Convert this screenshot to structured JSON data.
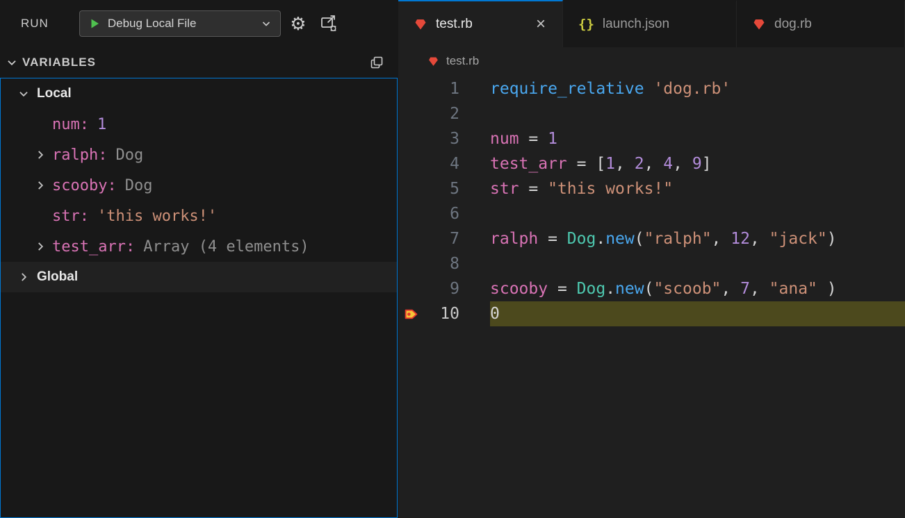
{
  "colors": {
    "accent": "#0078d4",
    "editor-bg": "#1f1f1f",
    "side-bg": "#181818",
    "current-line-bg": "#4c491d",
    "tok-kw": "#4aa8f0",
    "tok-var": "#d973b5",
    "tok-num": "#b38cdb",
    "tok-str": "#ce9178",
    "tok-cls": "#4ec9b0",
    "tok-plain": "#d6d6d6",
    "type-gray": "#8f8f8f",
    "line-num": "#6e7681",
    "ruby-red": "#e5493a",
    "json-yellow": "#cbcb41",
    "play-green": "#4fc14f"
  },
  "run_panel": {
    "title": "RUN",
    "config_label": "Debug Local File"
  },
  "variables_panel": {
    "header": "VARIABLES",
    "groups": [
      {
        "label": "Local",
        "expanded": true,
        "items": [
          {
            "name": "num",
            "value": "1",
            "kind": "number",
            "expandable": false
          },
          {
            "name": "ralph",
            "value": "Dog",
            "kind": "type",
            "expandable": true
          },
          {
            "name": "scooby",
            "value": "Dog",
            "kind": "type",
            "expandable": true
          },
          {
            "name": "str",
            "value": "'this works!'",
            "kind": "string",
            "expandable": false
          },
          {
            "name": "test_arr",
            "value": "Array (4 elements)",
            "kind": "type",
            "expandable": true
          }
        ]
      },
      {
        "label": "Global",
        "expanded": false,
        "items": []
      }
    ]
  },
  "tabs": [
    {
      "label": "test.rb",
      "icon": "ruby",
      "active": true
    },
    {
      "label": "launch.json",
      "icon": "json",
      "active": false
    },
    {
      "label": "dog.rb",
      "icon": "ruby",
      "active": false
    }
  ],
  "breadcrumb": {
    "file": "test.rb"
  },
  "editor": {
    "lines": [
      {
        "num": "1",
        "tokens": [
          [
            "kw",
            "require_relative"
          ],
          [
            "plain",
            " "
          ],
          [
            "str",
            "'dog.rb'"
          ]
        ]
      },
      {
        "num": "2",
        "tokens": []
      },
      {
        "num": "3",
        "tokens": [
          [
            "var",
            "num"
          ],
          [
            "plain",
            " = "
          ],
          [
            "num",
            "1"
          ]
        ]
      },
      {
        "num": "4",
        "tokens": [
          [
            "var",
            "test_arr"
          ],
          [
            "plain",
            " = ["
          ],
          [
            "num",
            "1"
          ],
          [
            "plain",
            ", "
          ],
          [
            "num",
            "2"
          ],
          [
            "plain",
            ", "
          ],
          [
            "num",
            "4"
          ],
          [
            "plain",
            ", "
          ],
          [
            "num",
            "9"
          ],
          [
            "plain",
            "]"
          ]
        ]
      },
      {
        "num": "5",
        "tokens": [
          [
            "var",
            "str"
          ],
          [
            "plain",
            " = "
          ],
          [
            "str",
            "\"this works!\""
          ]
        ]
      },
      {
        "num": "6",
        "tokens": []
      },
      {
        "num": "7",
        "tokens": [
          [
            "var",
            "ralph"
          ],
          [
            "plain",
            " = "
          ],
          [
            "cls",
            "Dog"
          ],
          [
            "plain",
            "."
          ],
          [
            "kw",
            "new"
          ],
          [
            "plain",
            "("
          ],
          [
            "str",
            "\"ralph\""
          ],
          [
            "plain",
            ", "
          ],
          [
            "num",
            "12"
          ],
          [
            "plain",
            ", "
          ],
          [
            "str",
            "\"jack\""
          ],
          [
            "plain",
            ")"
          ]
        ]
      },
      {
        "num": "8",
        "tokens": []
      },
      {
        "num": "9",
        "tokens": [
          [
            "var",
            "scooby"
          ],
          [
            "plain",
            " = "
          ],
          [
            "cls",
            "Dog"
          ],
          [
            "plain",
            "."
          ],
          [
            "kw",
            "new"
          ],
          [
            "plain",
            "("
          ],
          [
            "str",
            "\"scoob\""
          ],
          [
            "plain",
            ", "
          ],
          [
            "num",
            "7"
          ],
          [
            "plain",
            ", "
          ],
          [
            "str",
            "\"ana\""
          ],
          [
            "plain",
            " )"
          ]
        ]
      },
      {
        "num": "10",
        "tokens": [
          [
            "plain",
            "0"
          ]
        ],
        "current": true,
        "breakpoint": true
      }
    ]
  }
}
